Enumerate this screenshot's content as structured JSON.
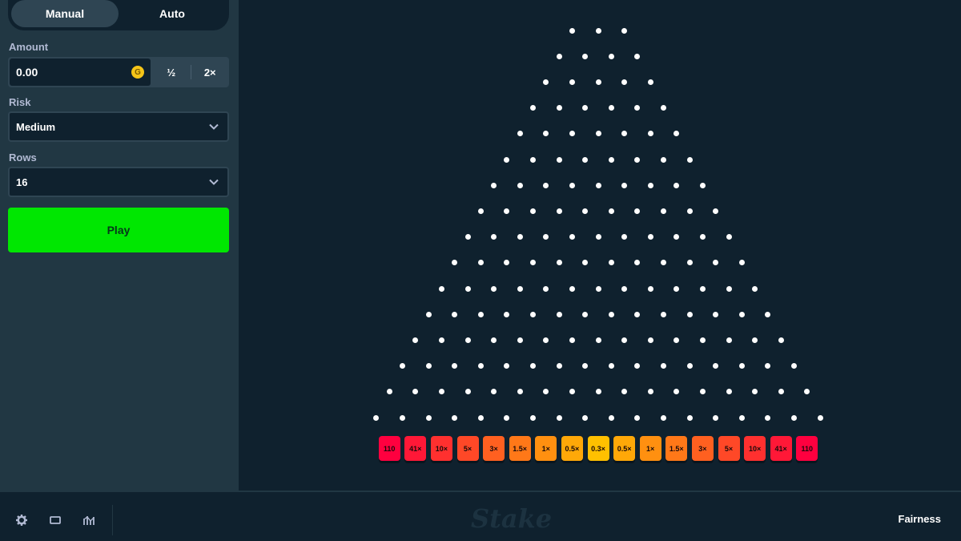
{
  "sidebar": {
    "tabs": [
      {
        "label": "Manual",
        "active": true
      },
      {
        "label": "Auto",
        "active": false
      }
    ],
    "amount": {
      "label": "Amount",
      "value": "0.00",
      "coin_symbol": "G",
      "half_label": "½",
      "double_label": "2×"
    },
    "risk": {
      "label": "Risk",
      "value": "Medium"
    },
    "rows": {
      "label": "Rows",
      "value": "16"
    },
    "play_label": "Play"
  },
  "board": {
    "rows": 16,
    "multipliers": [
      "110",
      "41×",
      "10×",
      "5×",
      "3×",
      "1.5×",
      "1×",
      "0.5×",
      "0.3×",
      "0.5×",
      "1×",
      "1.5×",
      "3×",
      "5×",
      "10×",
      "41×",
      "110"
    ],
    "multiplier_colors": [
      "#ff003f",
      "#ff1837",
      "#ff302f",
      "#ff4827",
      "#ff6020",
      "#ff7818",
      "#ff9010",
      "#ffa808",
      "#ffc000",
      "#ffa808",
      "#ff9010",
      "#ff7818",
      "#ff6020",
      "#ff4827",
      "#ff302f",
      "#ff1837",
      "#ff003f"
    ]
  },
  "footer": {
    "icons": [
      "gear-icon",
      "theatre-mode-icon",
      "live-stats-icon"
    ],
    "logo_text": "Stake",
    "fairness_label": "Fairness"
  },
  "colors": {
    "play": "#00e701",
    "sidebar": "#213743",
    "background": "#0f212e"
  }
}
